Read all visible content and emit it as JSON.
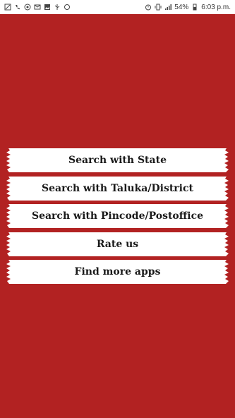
{
  "status_bar": {
    "left_icons": [
      "gallery-icon",
      "call-icon",
      "whatsapp-icon",
      "message-icon",
      "image-icon",
      "usb-icon",
      "ring-icon"
    ],
    "right_icons": [
      "alarm-icon",
      "vibrate-icon",
      "signal-icon",
      "battery-icon"
    ],
    "battery": "54%",
    "time": "6:03 p.m."
  },
  "menu": {
    "items": [
      {
        "label": "Search with State"
      },
      {
        "label": "Search with Taluka/District"
      },
      {
        "label": "Search with Pincode/Postoffice"
      },
      {
        "label": "Rate us"
      },
      {
        "label": "Find more apps"
      }
    ]
  },
  "colors": {
    "background": "#b22222",
    "button": "#ffffff",
    "text": "#1a1a1a"
  }
}
